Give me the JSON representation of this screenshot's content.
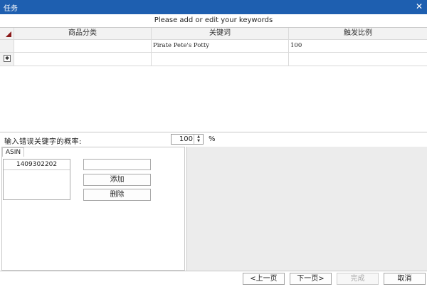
{
  "window": {
    "title": "任务",
    "close_glyph": "✕"
  },
  "heading": "Please add or edit your keywords",
  "grid": {
    "columns": [
      "商品分类",
      "关键词",
      "触发比例"
    ],
    "rows": [
      {
        "category": "",
        "keyword": "Pirate Pete's Potty",
        "ratio": "100"
      }
    ],
    "new_row_glyph": "✱"
  },
  "typo_rate": {
    "label": "输入错误关键字的概率:",
    "value": "100",
    "unit": "%"
  },
  "asin": {
    "tab_label": "ASIN",
    "items": [
      "1409302202"
    ],
    "input_value": "",
    "add_label": "添加",
    "delete_label": "删除"
  },
  "footer": {
    "prev_label": "<上一页",
    "next_label": "下一页>",
    "done_label": "完成",
    "cancel_label": "取消"
  }
}
